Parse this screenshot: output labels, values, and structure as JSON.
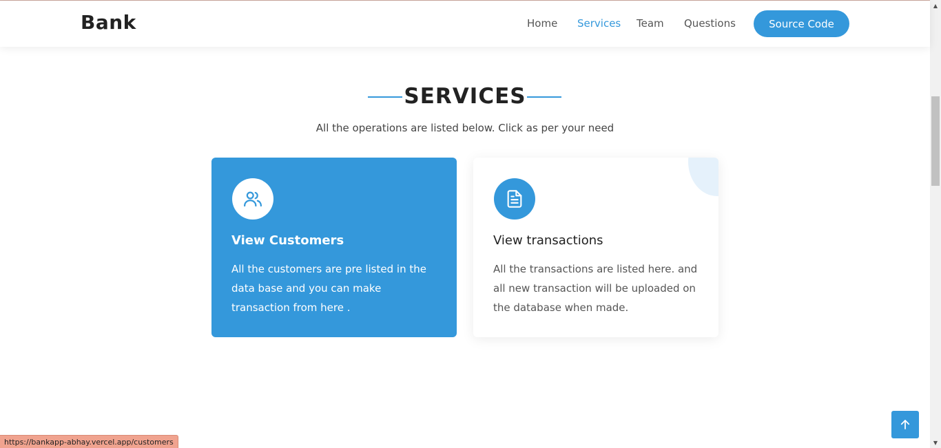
{
  "header": {
    "logo": "Bank",
    "nav": [
      {
        "label": "Home",
        "active": false
      },
      {
        "label": "Services",
        "active": true
      },
      {
        "label": "Team",
        "active": false
      },
      {
        "label": "Questions",
        "active": false
      }
    ],
    "cta_label": "Source Code"
  },
  "services": {
    "title": "SERVICES",
    "subtitle": "All the operations are listed below. Click as per your need",
    "cards": [
      {
        "icon": "users-icon",
        "title": "View Customers",
        "text": "All the customers are pre listed in the data base and you can make transaction from here ."
      },
      {
        "icon": "document-icon",
        "title": "View transactions",
        "text": "All the transactions are listed here. and all new transaction will be uploaded on the database when made."
      }
    ]
  },
  "back_to_top": {
    "icon": "arrow-up-icon"
  },
  "status_bar": {
    "url": "https://bankapp-abhay.vercel.app/customers"
  },
  "colors": {
    "accent": "#3498db",
    "text_dark": "#222222",
    "text": "#444444"
  }
}
